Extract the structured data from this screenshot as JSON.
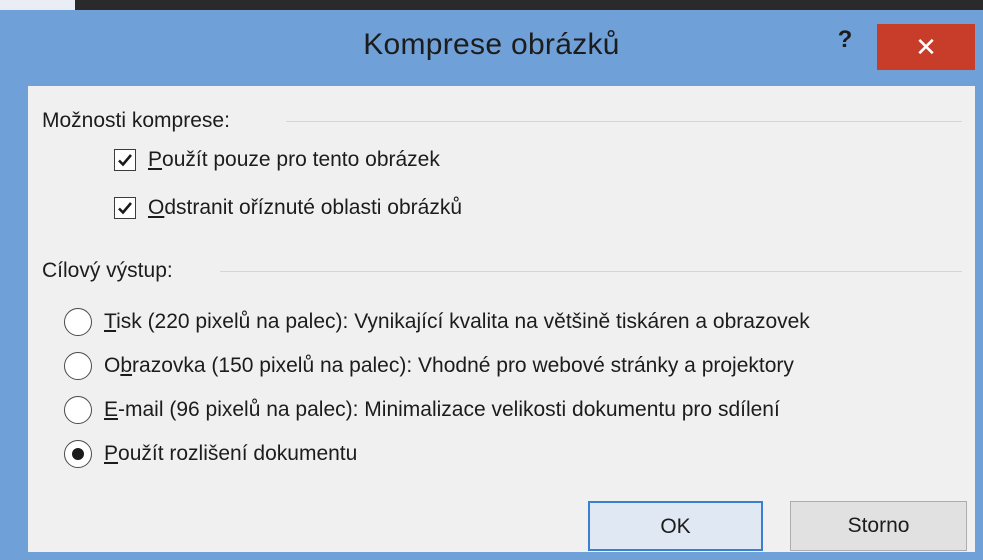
{
  "window": {
    "title": "Komprese obrázků",
    "help_label": "?",
    "close_label": "✕"
  },
  "compression_group": {
    "label": "Možnosti komprese:",
    "options": [
      {
        "mnemonic": "P",
        "rest": "oužít pouze pro tento obrázek",
        "checked": true
      },
      {
        "mnemonic": "O",
        "rest": "dstranit oříznuté oblasti obrázků",
        "checked": true
      }
    ]
  },
  "output_group": {
    "label": "Cílový výstup:",
    "options": [
      {
        "pre": "",
        "mnemonic": "T",
        "rest": "isk (220 pixelů na palec): Vynikající kvalita na většině tiskáren a obrazovek",
        "selected": false
      },
      {
        "pre": "O",
        "mnemonic": "b",
        "rest": "razovka (150 pixelů na palec): Vhodné pro webové stránky a projektory",
        "selected": false
      },
      {
        "pre": "",
        "mnemonic": "E",
        "rest": "-mail (96 pixelů na palec): Minimalizace velikosti dokumentu pro sdílení",
        "selected": false
      },
      {
        "pre": "",
        "mnemonic": "P",
        "rest": "oužít rozlišení dokumentu",
        "selected": true
      }
    ]
  },
  "buttons": {
    "ok_label": "OK",
    "cancel_label": "Storno"
  }
}
